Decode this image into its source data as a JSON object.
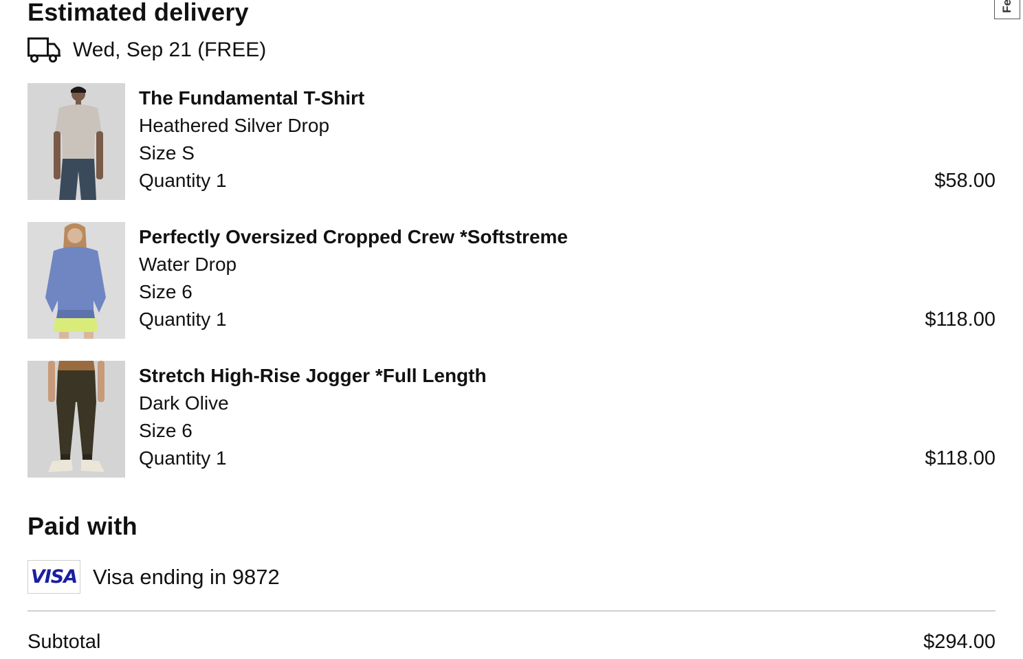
{
  "feedback_tab": {
    "label": "Fe"
  },
  "delivery": {
    "title": "Estimated delivery",
    "icon": "truck-icon",
    "date_text": "Wed, Sep 21 (FREE)"
  },
  "items": [
    {
      "name": "The Fundamental T-Shirt",
      "color": "Heathered Silver Drop",
      "size": "Size S",
      "quantity": "Quantity 1",
      "price": "$58.00",
      "image": "product-image-tshirt"
    },
    {
      "name": "Perfectly Oversized Cropped Crew *Softstreme",
      "color": "Water Drop",
      "size": "Size 6",
      "quantity": "Quantity 1",
      "price": "$118.00",
      "image": "product-image-crew"
    },
    {
      "name": "Stretch High-Rise Jogger *Full Length",
      "color": "Dark Olive",
      "size": "Size 6",
      "quantity": "Quantity 1",
      "price": "$118.00",
      "image": "product-image-jogger"
    }
  ],
  "payment": {
    "title": "Paid with",
    "card_logo_text": "VISA",
    "card_text": "Visa ending in 9872"
  },
  "summary": {
    "subtotal_label": "Subtotal",
    "subtotal_value": "$294.00"
  },
  "colors": {
    "text": "#111111",
    "divider": "#d0d0d0",
    "visa_blue": "#1a1f9e"
  }
}
